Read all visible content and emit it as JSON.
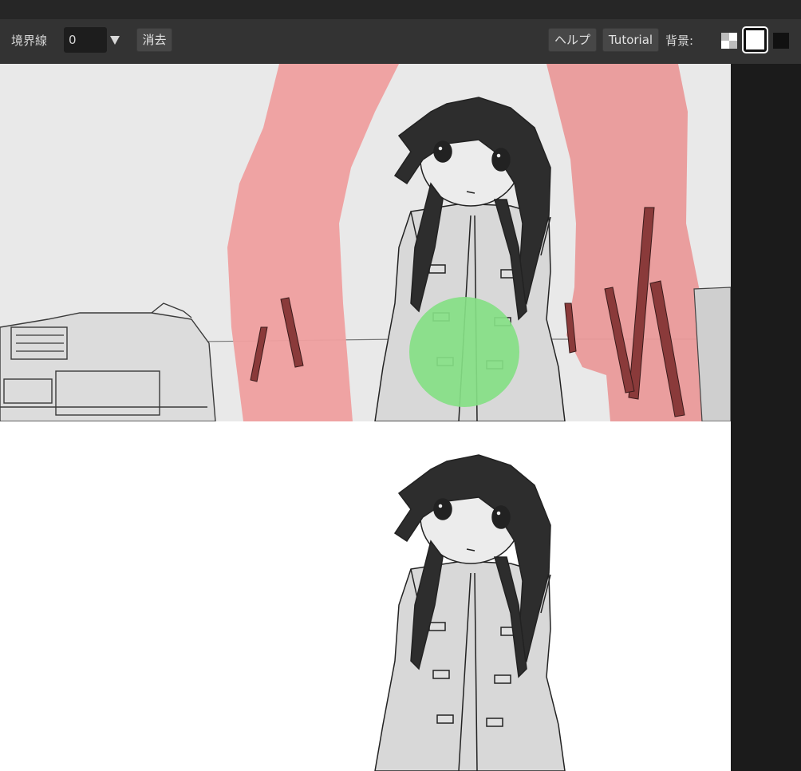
{
  "toolbar": {
    "border_label": "境界線",
    "border_value": "0",
    "clear_label": "消去",
    "help_label": "ヘルプ",
    "tutorial_label": "Tutorial",
    "background_label": "背景:",
    "background_options": [
      "checker",
      "white",
      "black"
    ],
    "background_selected": "white"
  },
  "colors": {
    "toolbar_bg": "#333333",
    "remove_mask": "#ef8f8f",
    "keep_mask": "#7ee07e"
  }
}
